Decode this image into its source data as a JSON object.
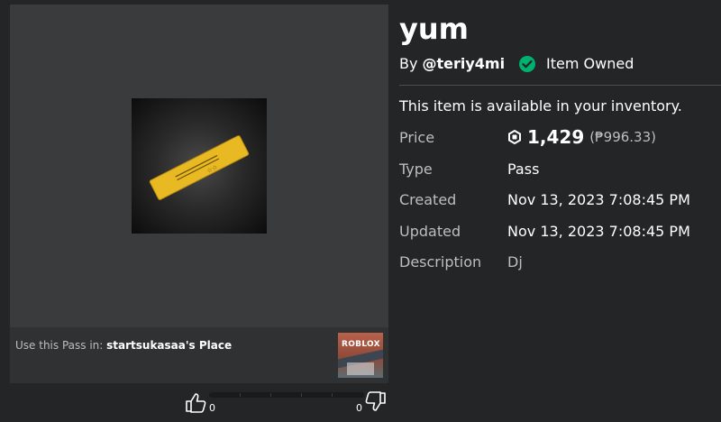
{
  "item": {
    "title": "yum",
    "by_label": "By",
    "creator": "@teriy4mi",
    "owned_text": "Item Owned",
    "availability": "This item is available in your inventory."
  },
  "fields": {
    "price_label": "Price",
    "price_amount": "1,429",
    "price_conversion": "(₱996.33)",
    "type_label": "Type",
    "type_value": "Pass",
    "created_label": "Created",
    "created_value": "Nov 13, 2023 7:08:45 PM",
    "updated_label": "Updated",
    "updated_value": "Nov 13, 2023 7:08:45 PM",
    "description_label": "Description",
    "description_value": "Dj"
  },
  "place": {
    "prefix": "Use this Pass in:",
    "name": "startsukasaa's Place",
    "thumb_text": "ROBLOX"
  },
  "votes": {
    "up": "0",
    "down": "0"
  },
  "colors": {
    "background": "#232527",
    "panel": "#393b3d",
    "owned_green": "#00b06f",
    "pass_gold": "#e8b923"
  },
  "icons": {
    "owned": "check-circle-icon",
    "currency": "robux-icon",
    "vote_up": "thumbs-up-icon",
    "vote_down": "thumbs-down-icon"
  }
}
